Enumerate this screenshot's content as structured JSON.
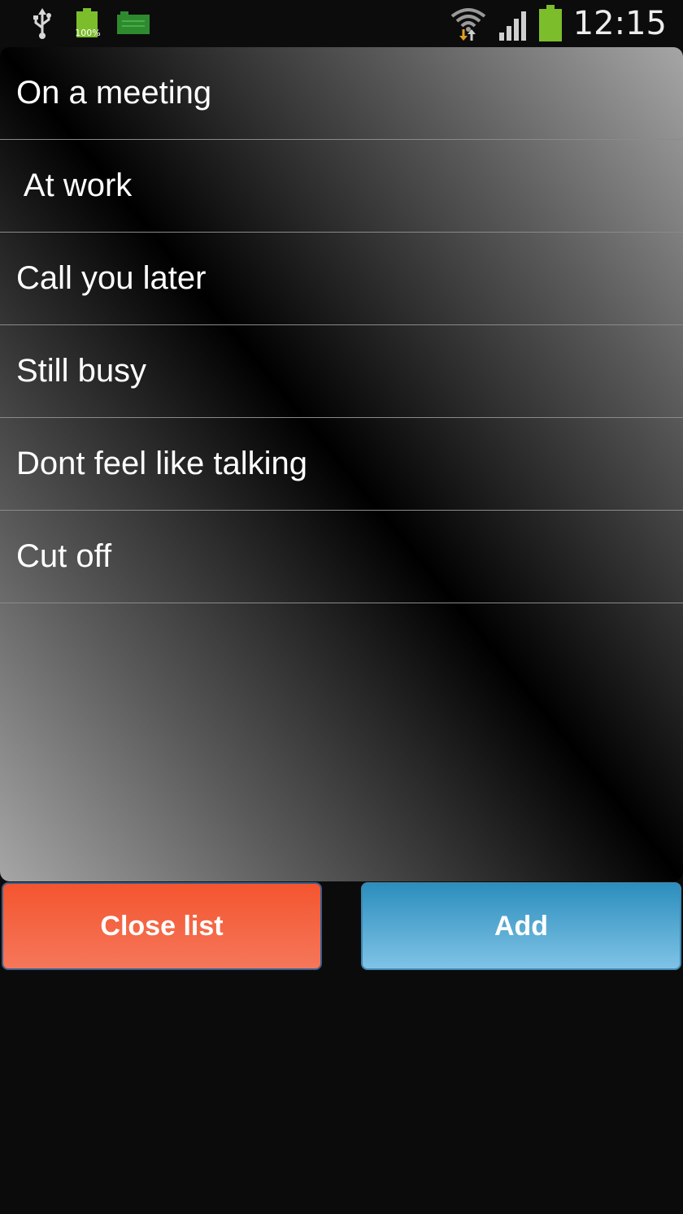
{
  "status_bar": {
    "battery_small_percent": "100%",
    "time": "12:15",
    "icons": [
      "usb-icon",
      "battery-full-icon",
      "sd-card-icon",
      "wifi-transfer-icon",
      "cell-signal-icon",
      "battery-icon"
    ],
    "colors": {
      "battery_green": "#7cbd2c",
      "sd_green": "#2f8a2f"
    }
  },
  "list": {
    "items": [
      {
        "label": "On a meeting"
      },
      {
        "label": " At work"
      },
      {
        "label": "Call you later"
      },
      {
        "label": "Still busy"
      },
      {
        "label": "Dont feel like talking"
      },
      {
        "label": "Cut off"
      }
    ]
  },
  "buttons": {
    "close_label": "Close list",
    "add_label": "Add",
    "close_color": "#f4552f",
    "add_color": "#2c8ebd"
  }
}
